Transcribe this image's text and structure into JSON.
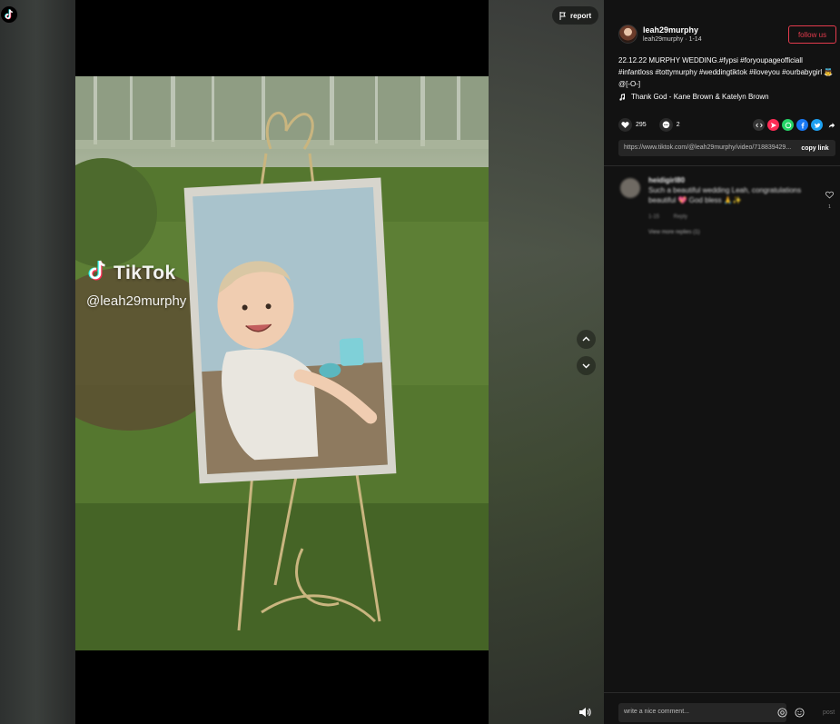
{
  "stage": {
    "report_label": "report",
    "watermark": {
      "brand": "TikTok",
      "handle": "@leah29murphy"
    }
  },
  "panel": {
    "author": {
      "name": "leah29murphy",
      "sub": "leah29murphy · 1-14"
    },
    "follow_label": "follow us",
    "caption": "22.12.22 MURPHY WEDDING.#fypsi #foryoupageofficiall #infantloss #tottymurphy #weddingtiktok #iloveyou #ourbabygirl 👼@[-O-]",
    "music": "Thank God - Kane Brown & Katelyn Brown",
    "likes": "295",
    "comments": "2",
    "link_url": "https://www.tiktok.com/@leah29murphy/video/718839429...",
    "copy_label": "copy link",
    "comment": {
      "user": "heidigirl80",
      "text": "Such a beautiful wedding Leah, congratulations beautiful 💖 God bless 🙏✨",
      "meta": "1-15 Reply",
      "replies": "View more replies (1)",
      "likes": "1"
    },
    "comment_placeholder": "write a nice comment...",
    "post_label": "post"
  },
  "colors": {
    "accent": "#e33b4d",
    "panel_bg": "#121212",
    "field_bg": "#262626"
  }
}
